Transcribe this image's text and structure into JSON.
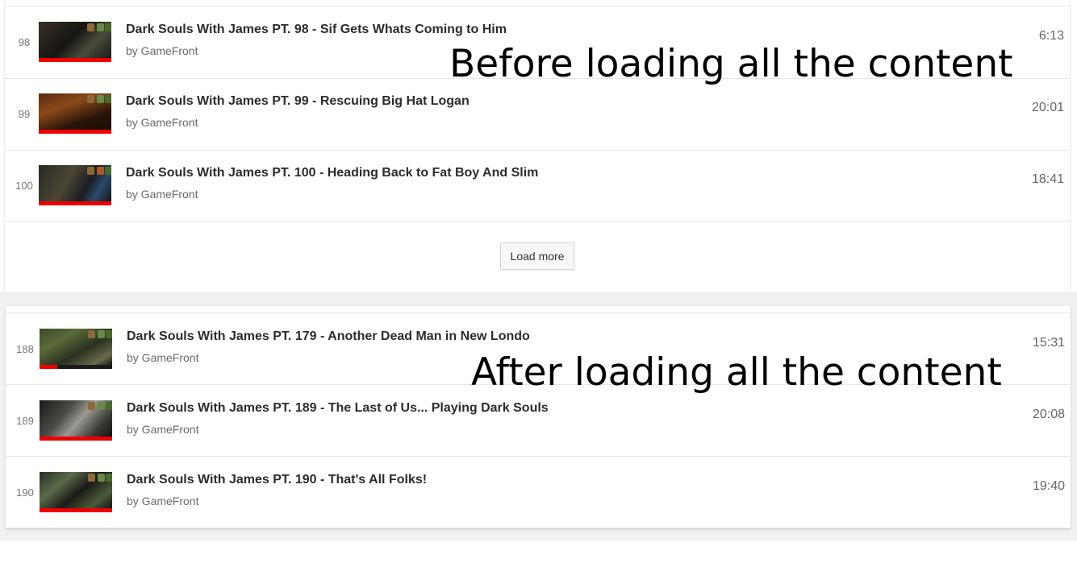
{
  "before": {
    "caption": "Before loading all the content",
    "load_more_label": "Load more",
    "videos": [
      {
        "index": "98",
        "title": "Dark Souls With James PT. 98 - Sif Gets Whats Coming to Him",
        "author": "by GameFront",
        "duration": "6:13"
      },
      {
        "index": "99",
        "title": "Dark Souls With James PT. 99 - Rescuing Big Hat Logan",
        "author": "by GameFront",
        "duration": "20:01"
      },
      {
        "index": "100",
        "title": "Dark Souls With James PT. 100 - Heading Back to Fat Boy And Slim",
        "author": "by GameFront",
        "duration": "18:41"
      }
    ]
  },
  "after": {
    "caption": "After loading all the content",
    "videos": [
      {
        "index": "188",
        "title": "Dark Souls With James PT. 179 - Another Dead Man in New Londo",
        "author": "by GameFront",
        "duration": "15:31"
      },
      {
        "index": "189",
        "title": "Dark Souls With James PT. 189 - The Last of Us... Playing Dark Souls",
        "author": "by GameFront",
        "duration": "20:08"
      },
      {
        "index": "190",
        "title": "Dark Souls With James PT. 190 - That's All Folks!",
        "author": "by GameFront",
        "duration": "19:40"
      }
    ]
  },
  "colors": {
    "progress_bar": "#ee0000",
    "background_strip": "#f1f1f1",
    "caption_text": "#000000"
  }
}
